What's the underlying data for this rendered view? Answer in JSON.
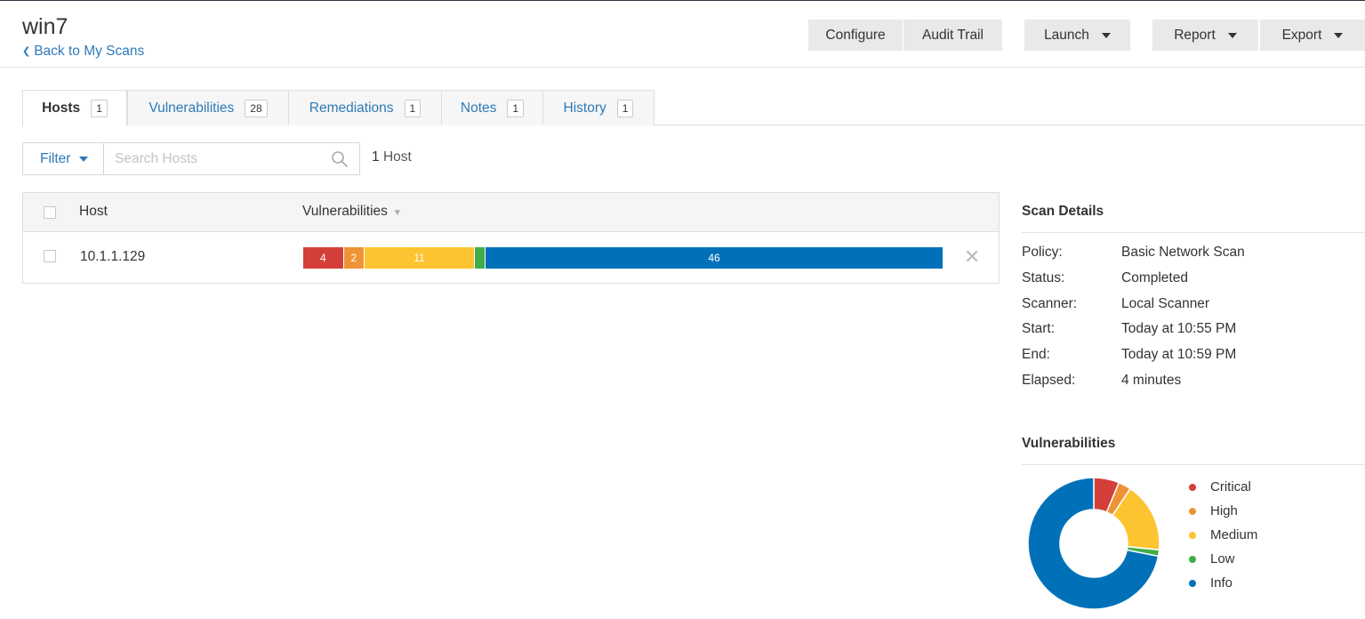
{
  "header": {
    "title": "win7",
    "back_label": "Back to My Scans",
    "buttons": {
      "configure": "Configure",
      "audit_trail": "Audit Trail",
      "launch": "Launch",
      "report": "Report",
      "export": "Export"
    }
  },
  "tabs": [
    {
      "label": "Hosts",
      "count": "1"
    },
    {
      "label": "Vulnerabilities",
      "count": "28"
    },
    {
      "label": "Remediations",
      "count": "1"
    },
    {
      "label": "Notes",
      "count": "1"
    },
    {
      "label": "History",
      "count": "1"
    }
  ],
  "filter": {
    "label": "Filter",
    "search_placeholder": "Search Hosts",
    "count_number": "1",
    "count_word": "Host"
  },
  "table": {
    "columns": {
      "host": "Host",
      "vulnerabilities": "Vulnerabilities"
    },
    "rows": [
      {
        "host": "10.1.1.129",
        "segments": [
          {
            "severity": "critical",
            "label": "4"
          },
          {
            "severity": "high",
            "label": "2"
          },
          {
            "severity": "medium",
            "label": "11"
          },
          {
            "severity": "low",
            "label": ""
          },
          {
            "severity": "info",
            "label": "46"
          }
        ]
      }
    ]
  },
  "scan_details": {
    "title": "Scan Details",
    "items": [
      {
        "label": "Policy:",
        "value": "Basic Network Scan"
      },
      {
        "label": "Status:",
        "value": "Completed"
      },
      {
        "label": "Scanner:",
        "value": "Local Scanner"
      },
      {
        "label": "Start:",
        "value": "Today at 10:55 PM"
      },
      {
        "label": "End:",
        "value": "Today at 10:59 PM"
      },
      {
        "label": "Elapsed:",
        "value": "4 minutes"
      }
    ]
  },
  "vuln_chart": {
    "title": "Vulnerabilities",
    "legend": [
      "Critical",
      "High",
      "Medium",
      "Low",
      "Info"
    ]
  },
  "colors": {
    "critical": "#d43f3a",
    "high": "#ee9336",
    "medium": "#fdc431",
    "low": "#3fae49",
    "info": "#0071b9",
    "link": "#2d7ab8"
  },
  "chart_data": {
    "type": "pie",
    "variant": "donut",
    "categories": [
      "Critical",
      "High",
      "Medium",
      "Low",
      "Info"
    ],
    "values": [
      4,
      2,
      11,
      1,
      46
    ],
    "legend_position": "right"
  }
}
